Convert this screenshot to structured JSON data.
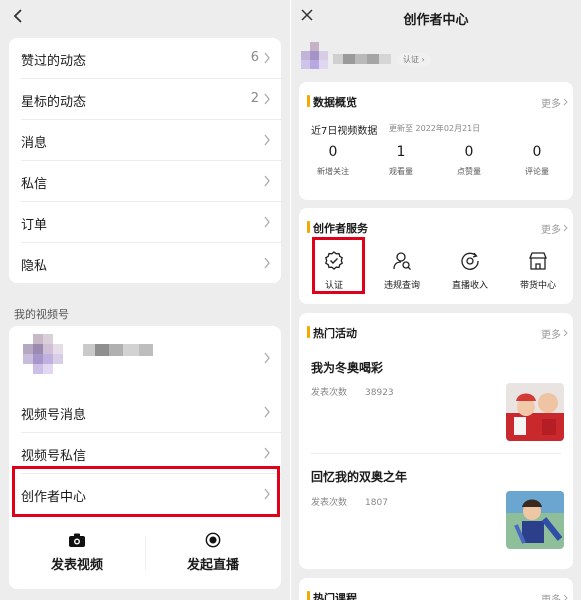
{
  "left": {
    "menu_items": [
      {
        "label": "赞过的动态",
        "count": "6"
      },
      {
        "label": "星标的动态",
        "count": "2"
      },
      {
        "label": "消息",
        "count": ""
      },
      {
        "label": "私信",
        "count": ""
      },
      {
        "label": "订单",
        "count": ""
      },
      {
        "label": "隐私",
        "count": ""
      }
    ],
    "section_title": "我的视频号",
    "channel_items": [
      {
        "label": "视频号消息"
      },
      {
        "label": "视频号私信"
      },
      {
        "label": "创作者中心"
      }
    ],
    "actions": [
      {
        "label": "发表视频",
        "icon": "camera-icon"
      },
      {
        "label": "发起直播",
        "icon": "live-icon"
      }
    ]
  },
  "right": {
    "title": "创作者中心",
    "verify_pill": "认证 ›",
    "overview": {
      "title": "数据概览",
      "more": "更多",
      "subtitle": "近7日视频数据",
      "updated": "更新至 2022年02月21日",
      "stats": [
        {
          "value": "0",
          "label": "新增关注"
        },
        {
          "value": "1",
          "label": "观看量"
        },
        {
          "value": "0",
          "label": "点赞量"
        },
        {
          "value": "0",
          "label": "评论量"
        }
      ]
    },
    "services": {
      "title": "创作者服务",
      "more": "更多",
      "items": [
        {
          "label": "认证",
          "icon": "verify-badge-icon"
        },
        {
          "label": "违规查询",
          "icon": "person-search-icon"
        },
        {
          "label": "直播收入",
          "icon": "income-icon"
        },
        {
          "label": "带货中心",
          "icon": "store-icon"
        }
      ]
    },
    "hot": {
      "title": "热门活动",
      "more": "更多",
      "items": [
        {
          "title": "我为冬奥喝彩",
          "meta_label": "发表次数",
          "meta_value": "38923"
        },
        {
          "title": "回忆我的双奥之年",
          "meta_label": "发表次数",
          "meta_value": "1807"
        }
      ]
    },
    "courses": {
      "title": "热门课程",
      "more": "更多"
    }
  },
  "colors": {
    "accent": "#f2a900",
    "highlight": "#e0001a",
    "background": "#ededed"
  }
}
